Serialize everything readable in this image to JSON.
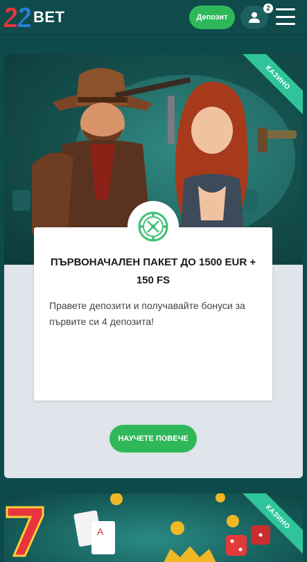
{
  "header": {
    "logo_text": "BET",
    "deposit_label": "Депозит",
    "notification_count": "2"
  },
  "promo": {
    "ribbon_label": "КАЗИНО",
    "title": "ПЪРВОНАЧАЛЕН ПАКЕТ ДО 1500 EUR + 150 FS",
    "description": "Правете депозити и получавайте бонуси за първите си 4 депозита!",
    "cta_label": "НАУЧЕТЕ ПОВЕЧЕ"
  },
  "promo2": {
    "ribbon_label": "КАЗИНО"
  },
  "colors": {
    "header_bg": "#0f4b4b",
    "accent_green": "#2fb85a",
    "ribbon": "#2fc49a",
    "logo_red": "#e8343c",
    "logo_blue": "#2a7fd4"
  }
}
